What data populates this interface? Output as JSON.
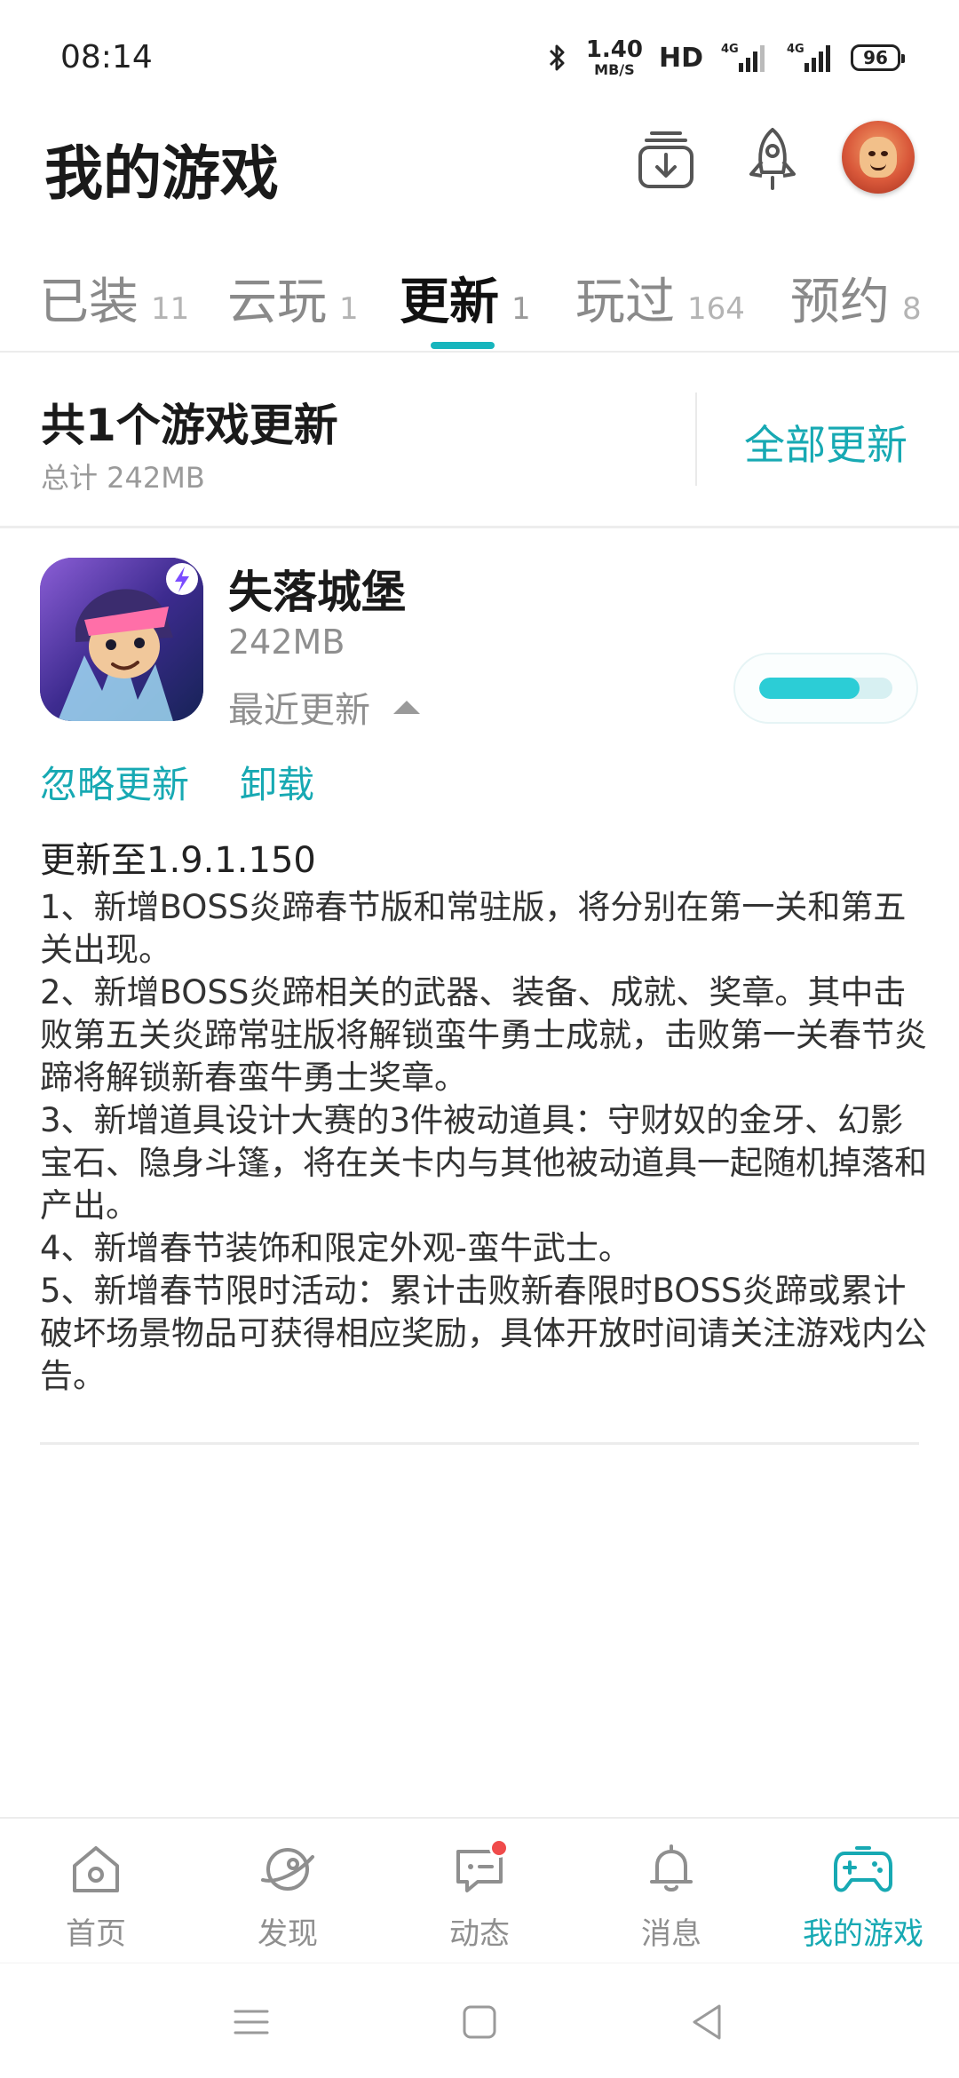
{
  "status_bar": {
    "time": "08:14",
    "net_speed_value": "1.40",
    "net_speed_unit": "MB/S",
    "hd": "HD",
    "battery": "96",
    "icons": [
      "bluetooth-icon",
      "signal-4g-icon",
      "signal-4g-icon"
    ]
  },
  "header": {
    "title": "我的游戏",
    "icons": [
      "download-icon",
      "rocket-icon",
      "avatar"
    ]
  },
  "tabs": [
    {
      "label": "已装",
      "count": "11",
      "active": false
    },
    {
      "label": "云玩",
      "count": "1",
      "active": false
    },
    {
      "label": "更新",
      "count": "1",
      "active": true
    },
    {
      "label": "玩过",
      "count": "164",
      "active": false
    },
    {
      "label": "预约",
      "count": "8",
      "active": false
    }
  ],
  "summary": {
    "title": "共1个游戏更新",
    "subtitle": "总计  242MB",
    "update_all": "全部更新"
  },
  "game": {
    "name": "失落城堡",
    "size": "242MB",
    "recent_label": "最近更新",
    "progress": 0.75,
    "ignore_label": "忽略更新",
    "uninstall_label": "卸载",
    "version_line": "更新至1.9.1.150",
    "notes": "1、新增BOSS炎蹄春节版和常驻版，将分别在第一关和第五关出现。\n2、新增BOSS炎蹄相关的武器、装备、成就、奖章。其中击败第五关炎蹄常驻版将解锁蛮牛勇士成就，击败第一关春节炎蹄将解锁新春蛮牛勇士奖章。\n3、新增道具设计大赛的3件被动道具：守财奴的金牙、幻影宝石、隐身斗篷，将在关卡内与其他被动道具一起随机掉落和产出。\n4、新增春节装饰和限定外观-蛮牛武士。\n5、新增春节限时活动：累计击败新春限时BOSS炎蹄或累计破坏场景物品可获得相应奖励，具体开放时间请关注游戏内公告。"
  },
  "bottom_nav": [
    {
      "label": "首页",
      "icon": "home-icon",
      "active": false
    },
    {
      "label": "发现",
      "icon": "discover-icon",
      "active": false
    },
    {
      "label": "动态",
      "icon": "chat-icon",
      "active": false,
      "badge": true
    },
    {
      "label": "消息",
      "icon": "bell-icon",
      "active": false
    },
    {
      "label": "我的游戏",
      "icon": "gamepad-icon",
      "active": true
    }
  ],
  "colors": {
    "accent": "#17a9b3",
    "badge": "#f04b4b"
  }
}
